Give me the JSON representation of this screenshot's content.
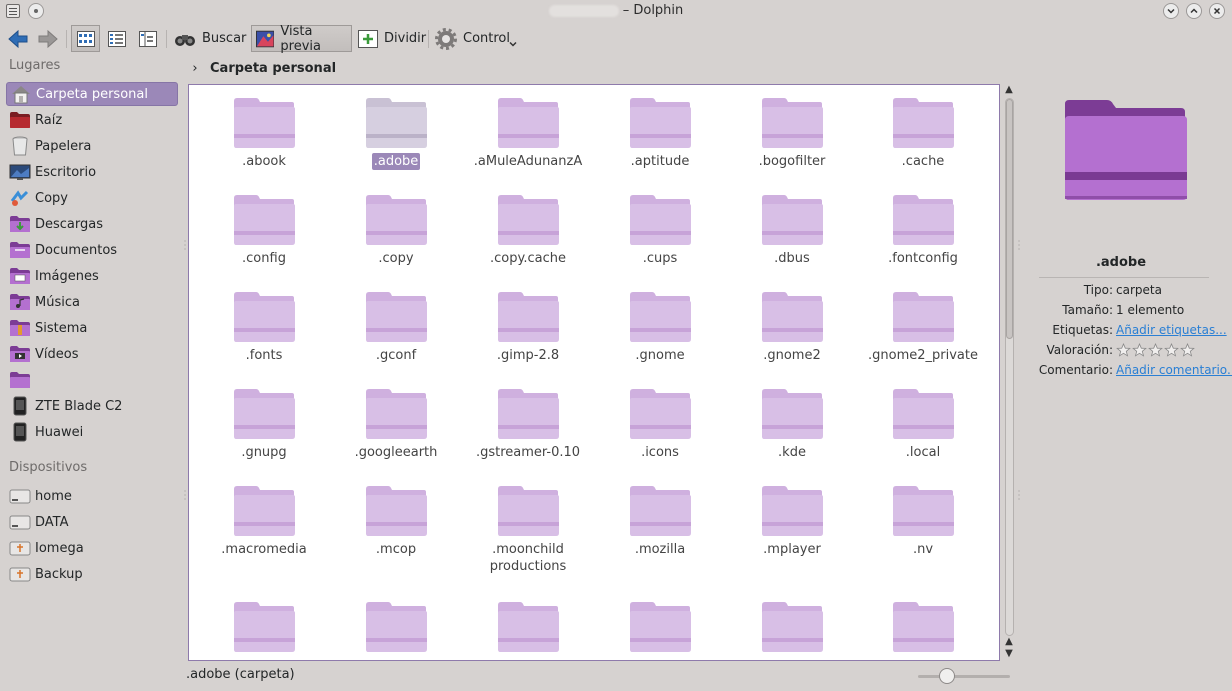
{
  "window": {
    "title": "– Dolphin"
  },
  "toolbar": {
    "search_label": "Buscar",
    "preview_label": "Vista previa",
    "split_label": "Dividir",
    "control_label": "Control"
  },
  "places": {
    "header": "Lugares",
    "items": [
      {
        "label": "Carpeta personal",
        "icon": "home-icon"
      },
      {
        "label": "Raíz",
        "icon": "root-folder-icon"
      },
      {
        "label": "Papelera",
        "icon": "trash-icon"
      },
      {
        "label": "Escritorio",
        "icon": "desktop-icon"
      },
      {
        "label": "Copy",
        "icon": "copy-app-icon"
      },
      {
        "label": "Descargas",
        "icon": "downloads-folder-icon"
      },
      {
        "label": "Documentos",
        "icon": "documents-folder-icon"
      },
      {
        "label": "Imágenes",
        "icon": "pictures-folder-icon"
      },
      {
        "label": "Música",
        "icon": "music-folder-icon"
      },
      {
        "label": "Sistema",
        "icon": "system-folder-icon"
      },
      {
        "label": "Vídeos",
        "icon": "videos-folder-icon"
      },
      {
        "label": "",
        "icon": "folder-icon"
      },
      {
        "label": "ZTE Blade C2",
        "icon": "phone-icon"
      },
      {
        "label": "Huawei",
        "icon": "phone-icon"
      }
    ]
  },
  "devices": {
    "header": "Dispositivos",
    "items": [
      {
        "label": "home",
        "icon": "drive-icon"
      },
      {
        "label": "DATA",
        "icon": "drive-icon"
      },
      {
        "label": "Iomega",
        "icon": "usb-drive-icon"
      },
      {
        "label": "Backup",
        "icon": "usb-drive-icon"
      }
    ]
  },
  "breadcrumb": {
    "path": "Carpeta personal"
  },
  "files": [
    ".abook",
    ".adobe",
    ".aMuleAdunanzA",
    ".aptitude",
    ".bogofilter",
    ".cache",
    ".config",
    ".copy",
    ".copy.cache",
    ".cups",
    ".dbus",
    ".fontconfig",
    ".fonts",
    ".gconf",
    ".gimp-2.8",
    ".gnome",
    ".gnome2",
    ".gnome2_private",
    ".gnupg",
    ".googleearth",
    ".gstreamer-0.10",
    ".icons",
    ".kde",
    ".local",
    ".macromedia",
    ".mcop",
    ".moonchild productions",
    ".mozilla",
    ".mplayer",
    ".nv",
    "",
    "",
    "",
    "",
    "",
    ""
  ],
  "selected_file": ".adobe",
  "status": {
    "text": ".adobe (carpeta)",
    "zoom_level": 0.27
  },
  "info": {
    "name": ".adobe",
    "type_label": "Tipo:",
    "type_value": "carpeta",
    "size_label": "Tamaño:",
    "size_value": "1 elemento",
    "tags_label": "Etiquetas:",
    "tags_value": "Añadir etiquetas...",
    "rating_label": "Valoración:",
    "rating_value": 0,
    "comment_label": "Comentario:",
    "comment_value": "Añadir comentario..."
  },
  "colors": {
    "accent": "#9b88b8",
    "folder": "#dcc6e8",
    "link": "#2a7fd4"
  }
}
